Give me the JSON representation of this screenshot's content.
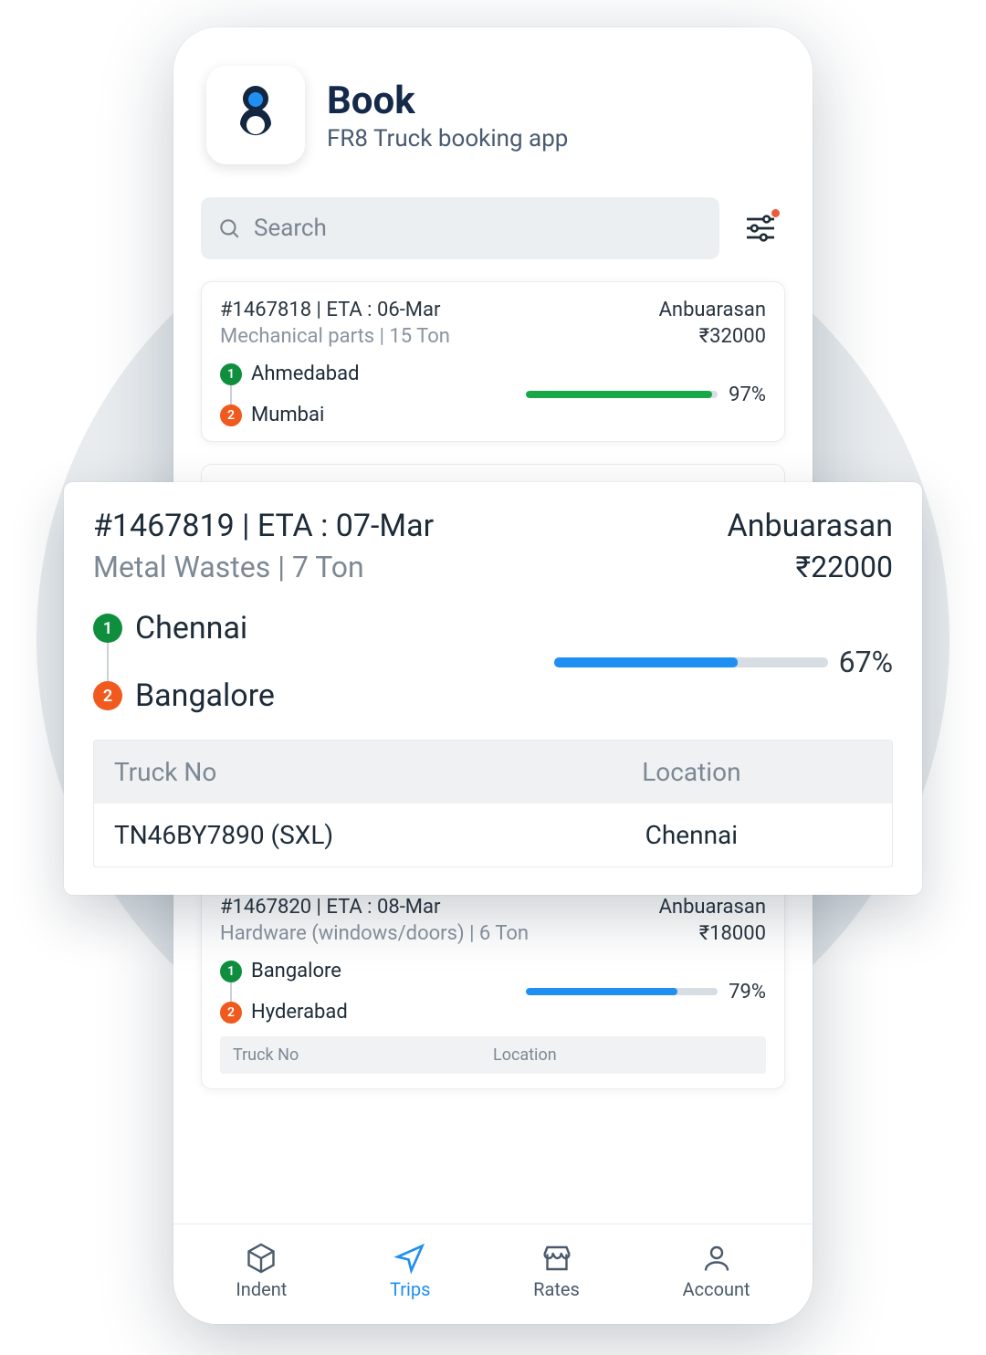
{
  "app": {
    "title": "Book",
    "subtitle": "FR8 Truck booking app"
  },
  "search": {
    "placeholder": "Search"
  },
  "cards": [
    {
      "id": "1467818",
      "eta": "06-Mar",
      "idLine": "#1467818 | ETA : 06-Mar",
      "cargoLine": "Mechanical parts | 15 Ton",
      "customer": "Anbuarasan",
      "price": "₹32000",
      "from": "Ahmedabad",
      "to": "Mumbai",
      "progress": 97,
      "progressLabel": "97%",
      "barColor": "green"
    },
    {
      "id": "1467819",
      "eta": "07-Mar",
      "idLine": "#1467819 | ETA : 07-Mar",
      "cargoLine": "Metal Wastes | 7 Ton",
      "customer": "Anbuarasan",
      "price": "₹22000",
      "from": "Chennai",
      "to": "Bangalore",
      "progress": 67,
      "progressLabel": "67%",
      "barColor": "blue",
      "truck": {
        "no": "TN46BY7890 (SXL)",
        "location": "Chennai"
      }
    },
    {
      "id": "1467820",
      "eta": "08-Mar",
      "idLine": "#1467820 | ETA : 08-Mar",
      "cargoLine": "Hardware (windows/doors) | 6 Ton",
      "customer": "Anbuarasan",
      "price": "₹18000",
      "from": "Bangalore",
      "to": "Hyderabad",
      "progress": 79,
      "progressLabel": "79%",
      "barColor": "blue"
    }
  ],
  "table": {
    "headers": {
      "truckNo": "Truck No",
      "location": "Location"
    }
  },
  "nav": {
    "indent": "Indent",
    "trips": "Trips",
    "rates": "Rates",
    "account": "Account"
  }
}
